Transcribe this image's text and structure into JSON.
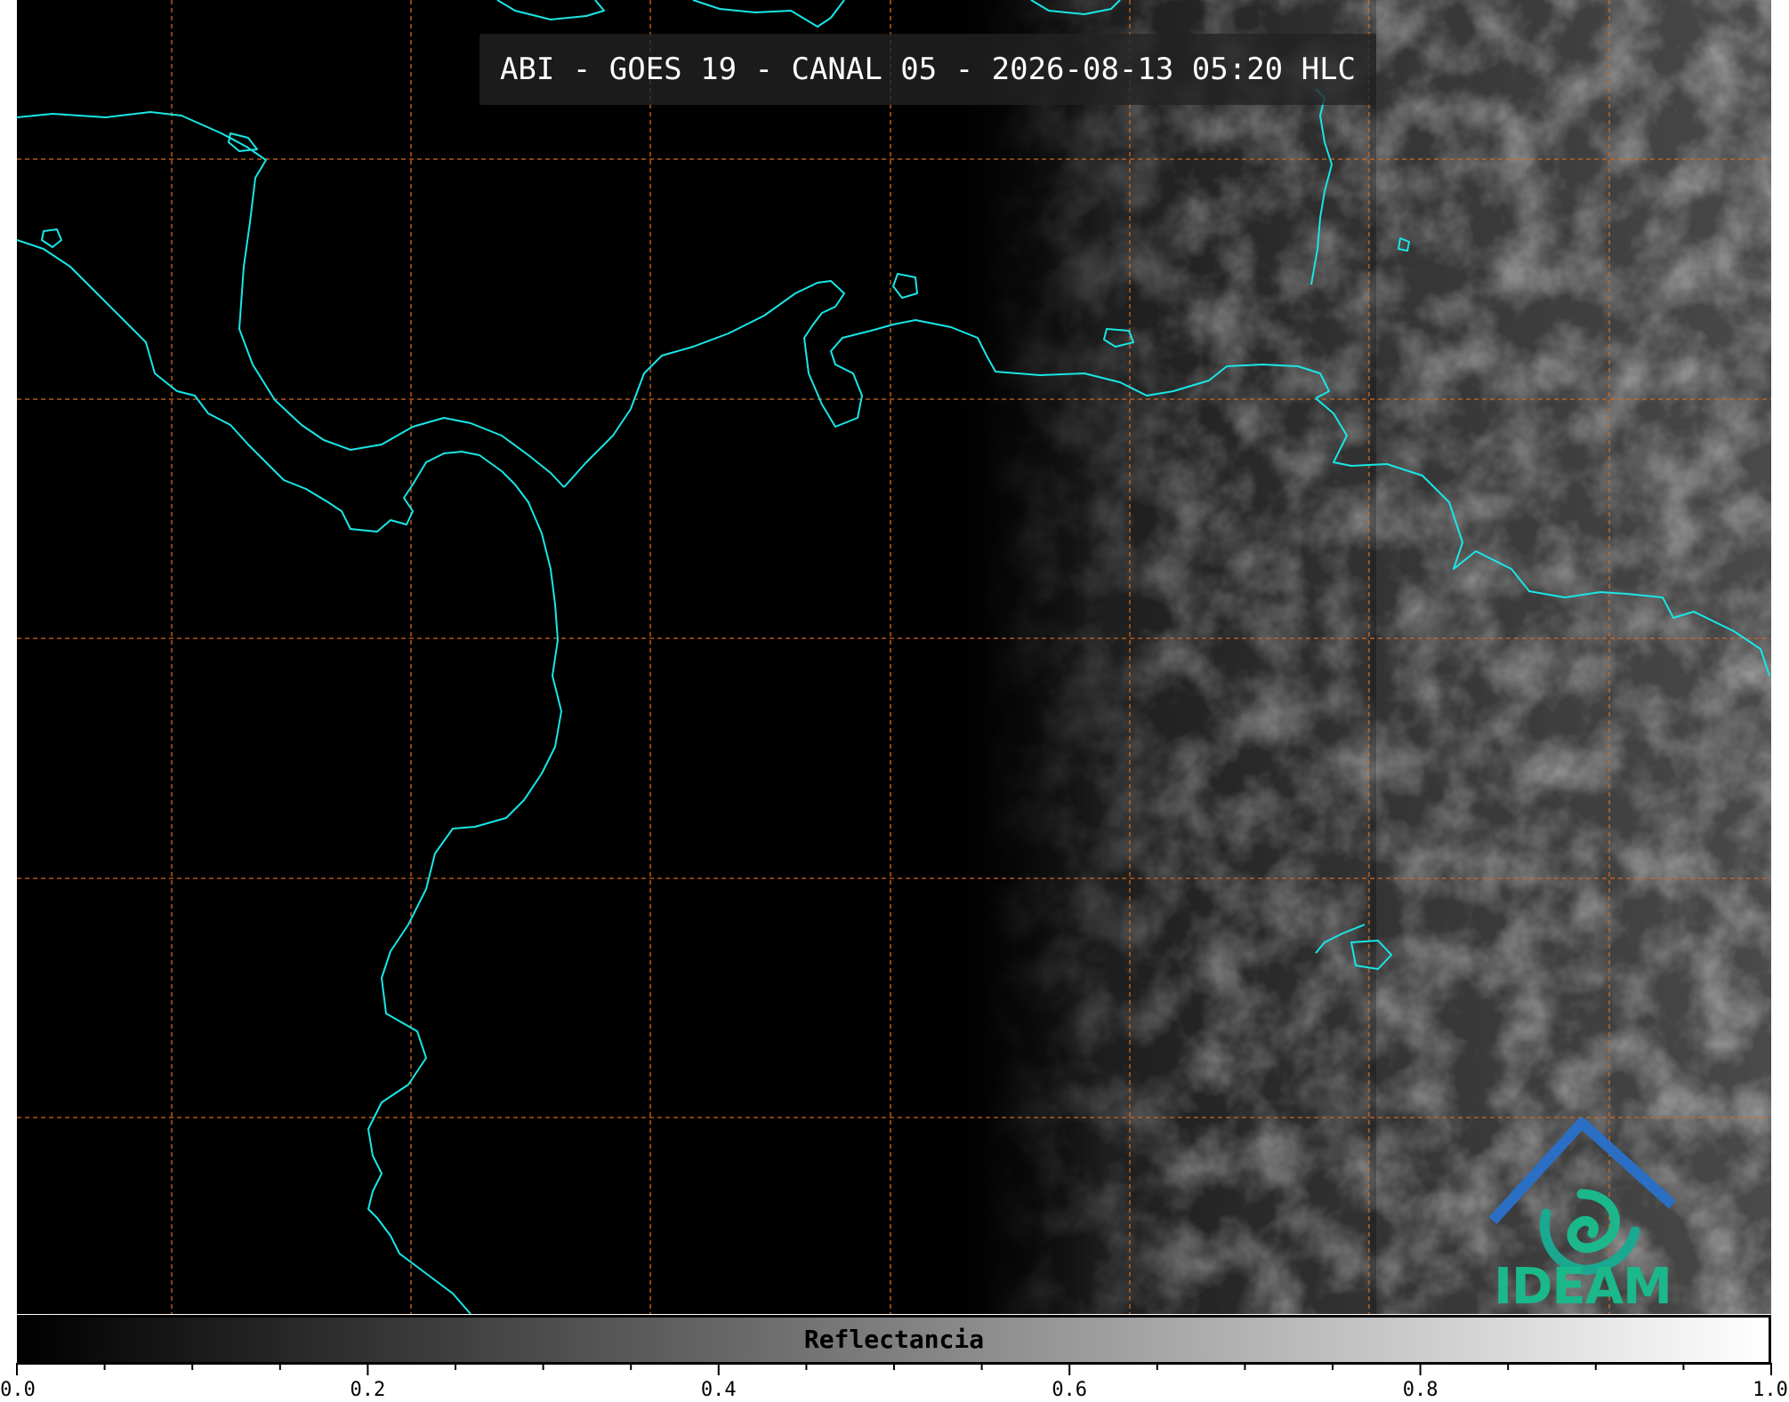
{
  "title": "ABI - GOES 19 - CANAL 05 - 2026-08-13 05:20 HLC",
  "colorbar": {
    "label": "Reflectancia",
    "min": 0.0,
    "max": 1.0,
    "tick_labels": [
      "0.0",
      "0.2",
      "0.4",
      "0.6",
      "0.8",
      "1.0"
    ],
    "colormap": [
      "#000000",
      "#ffffff"
    ]
  },
  "logo": {
    "text": "IDEAM",
    "roof_color": "#2a6fc4",
    "swirl_color": "#1ab88a"
  },
  "map": {
    "coastline_color": "#19e6e6",
    "gridline_color": "#d2691e",
    "gridline_style": "dashed",
    "background_color": "#000000"
  }
}
